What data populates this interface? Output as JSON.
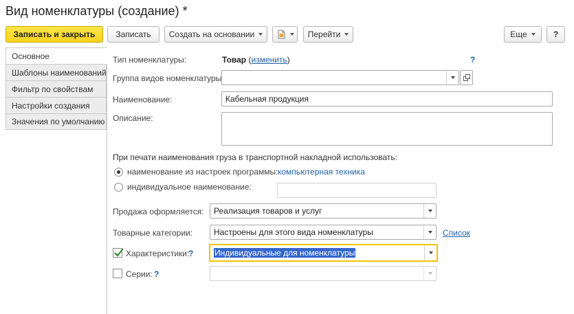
{
  "window": {
    "title": "Вид номенклатуры (создание) *"
  },
  "toolbar": {
    "save_close": "Записать и закрыть",
    "save": "Записать",
    "create_based": "Создать на основании",
    "goto": "Перейти",
    "more": "Еще",
    "help": "?"
  },
  "tabs": [
    "Основное",
    "Шаблоны наименований",
    "Фильтр по свойствам",
    "Настройки создания",
    "Значения по умолчанию"
  ],
  "form": {
    "type_label": "Тип номенклатуры:",
    "type_value": "Товар",
    "type_change_open": "(",
    "type_change": "изменить",
    "type_change_close": ")",
    "group_label": "Группа видов номенклатуры:",
    "group_value": "",
    "name_label": "Наименование:",
    "name_value": "Кабельная продукция",
    "desc_label": "Описание:",
    "desc_value": "",
    "print_heading": "При печати наименования груза в транспортной накладной использовать:",
    "radio_settings_label": "наименование из настроек программы:",
    "radio_settings_value": "компьютерная техника",
    "radio_individual_label": "индивидуальное наименование:",
    "individual_value": "",
    "sale_label": "Продажа оформляется:",
    "sale_value": "Реализация товаров и услуг",
    "categories_label": "Товарные категории:",
    "categories_value": "Настроены для этого вида номенклатуры",
    "categories_link": "Список",
    "characteristics_label": "Характеристики:",
    "characteristics_value": "Индивидуальные для номенклатуры",
    "series_label": "Серии:",
    "series_value": "",
    "help_mark": "?"
  },
  "colors": {
    "primary_button": "#f7d21e",
    "link": "#1f5fa8",
    "focus": "#f0c400",
    "selection": "#3366cc"
  }
}
